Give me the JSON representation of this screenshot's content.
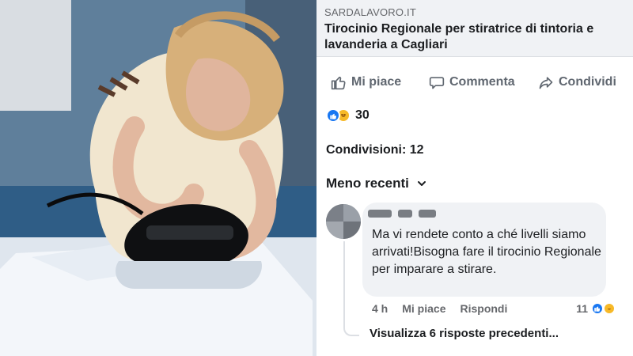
{
  "post": {
    "link_domain": "SARDALAVORO.IT",
    "link_title": "Tirocinio Regionale per stiratrice di tintoria e lavanderia a Cagliari",
    "actions": {
      "like": "Mi piace",
      "comment": "Commenta",
      "share": "Condividi"
    },
    "reactions": {
      "count": "30",
      "icons": [
        "like-reaction-icon",
        "haha-reaction-icon"
      ]
    },
    "shares_text": "Condivisioni: 12",
    "sort_label": "Meno recenti",
    "comment": {
      "text": "Ma vi rendete conto a ché livelli siamo arrivati!Bisogna fare il tirocinio Regionale per imparare a stirare.",
      "time": "4 h",
      "like": "Mi piace",
      "reply": "Rispondi",
      "reaction_count": "11"
    },
    "view_replies": "Visualizza 6 risposte precedenti..."
  },
  "colors": {
    "facebook_blue": "#1877f2",
    "haha_yellow": "#f7b928",
    "text_primary": "#1c1e21",
    "text_secondary": "#65676b",
    "bubble_bg": "#f0f2f5"
  }
}
